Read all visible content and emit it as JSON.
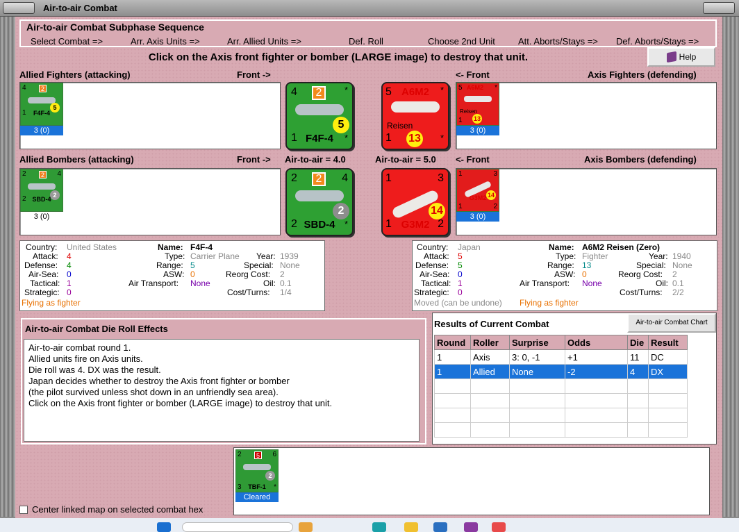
{
  "window": {
    "title": "Air-to-air Combat"
  },
  "sequence": {
    "title": "Air-to-air Combat Subphase Sequence",
    "steps": [
      "Select Combat =>",
      "Arr. Axis Units =>",
      "Arr. Allied Units =>",
      "Def. Roll",
      "Choose 2nd Unit",
      "Att. Aborts/Stays =>",
      "Def. Aborts/Stays =>"
    ]
  },
  "instruction": "Click on the Axis front fighter or bomber (LARGE image) to destroy that unit.",
  "help_label": "Help",
  "labels": {
    "allied_fighters": "Allied Fighters (attacking)",
    "front_right": "Front ->",
    "front_left": "<- Front",
    "axis_fighters": "Axis Fighters (defending)",
    "allied_bombers": "Allied Bombers (attacking)",
    "a2a_allied": "Air-to-air = 4.0",
    "a2a_axis": "Air-to-air = 5.0",
    "axis_bombers": "Axis Bombers (defending)"
  },
  "units": {
    "allied_fighter_mini": {
      "tl": "4",
      "tag": "2",
      "circ": "5",
      "bl": "1",
      "name": "F4F-4",
      "bar": "3 (0)"
    },
    "allied_fighter_big": {
      "tl": "4",
      "tag": "2",
      "tr": "*",
      "circ": "5",
      "bl": "1",
      "name": "F4F-4",
      "br": "*"
    },
    "axis_fighter_big": {
      "tl": "5",
      "topname": "A6M2",
      "tr": "*",
      "sub": "Reisen",
      "circ": "13",
      "bl": "1",
      "br": "*"
    },
    "axis_fighter_mini": {
      "tl": "5",
      "top": "A6M2",
      "tr": "*",
      "sub": "Reisen",
      "circ": "13",
      "bl": "1",
      "bar": "3 (0)"
    },
    "allied_bomber_mini": {
      "tl": "2",
      "tag": "2",
      "tr": "4",
      "circ": "2",
      "bl": "2",
      "name": "SBD-4",
      "bar": "3 (0)"
    },
    "allied_bomber_big": {
      "tl": "2",
      "tag": "2",
      "tr": "4",
      "circ": "2",
      "bl": "2",
      "name": "SBD-4",
      "br": "*"
    },
    "axis_bomber_big": {
      "tl": "1",
      "tr": "3",
      "circ": "14",
      "bl": "1",
      "name": "G3M2",
      "br": "2"
    },
    "axis_bomber_mini": {
      "tl": "1",
      "tr": "3",
      "circ": "14",
      "bl": "1",
      "name": "G3M2",
      "br": "2",
      "bar": "3 (0)"
    },
    "bottom_mini": {
      "tl": "2",
      "tag": "5",
      "tr": "6",
      "circ": "2",
      "bl": "3",
      "name": "TBF-1",
      "br": "*",
      "bar": "Cleared"
    }
  },
  "allied_info": {
    "country_k": "Country:",
    "country_v": "United States",
    "attack_k": "Attack:",
    "attack_v": "4",
    "defense_k": "Defense:",
    "defense_v": "4",
    "airsea_k": "Air-Sea:",
    "airsea_v": "0",
    "tactical_k": "Tactical:",
    "tactical_v": "1",
    "strategic_k": "Strategic:",
    "strategic_v": "0",
    "status": "Flying as fighter",
    "name_k": "Name:",
    "name_v": "F4F-4",
    "type_k": "Type:",
    "type_v": "Carrier Plane",
    "range_k": "Range:",
    "range_v": "5",
    "asw_k": "ASW:",
    "asw_v": "0",
    "airtransport_k": "Air Transport:",
    "airtransport_v": "None",
    "year_k": "Year:",
    "year_v": "1939",
    "special_k": "Special:",
    "special_v": "None",
    "reorg_k": "Reorg Cost:",
    "reorg_v": "2",
    "oil_k": "Oil:",
    "oil_v": "0.1",
    "cost_k": "Cost/Turns:",
    "cost_v": "1/4"
  },
  "axis_info": {
    "country_k": "Country:",
    "country_v": "Japan",
    "attack_k": "Attack:",
    "attack_v": "5",
    "defense_k": "Defense:",
    "defense_v": "5",
    "airsea_k": "Air-Sea:",
    "airsea_v": "0",
    "tactical_k": "Tactical:",
    "tactical_v": "1",
    "strategic_k": "Strategic:",
    "strategic_v": "0",
    "moved": "Moved (can be undone)",
    "status": "Flying as fighter",
    "name_k": "Name:",
    "name_v": "A6M2 Reisen (Zero)",
    "type_k": "Type:",
    "type_v": "Fighter",
    "range_k": "Range:",
    "range_v": "13",
    "asw_k": "ASW:",
    "asw_v": "0",
    "airtransport_k": "Air Transport:",
    "airtransport_v": "None",
    "year_k": "Year:",
    "year_v": "1940",
    "special_k": "Special:",
    "special_v": "None",
    "reorg_k": "Reorg Cost:",
    "reorg_v": "2",
    "oil_k": "Oil:",
    "oil_v": "0.1",
    "cost_k": "Cost/Turns:",
    "cost_v": "2/2"
  },
  "effects": {
    "title": "Air-to-air Combat Die Roll Effects",
    "lines": [
      "Air-to-air combat round 1.",
      "Allied units fire on Axis units.",
      "Die roll was 4.  DX was the result.",
      "Japan decides whether to destroy the Axis front fighter or bomber",
      "(the pilot survived unless shot down in an unfriendly sea area).",
      "Click on the Axis front fighter or bomber (LARGE image) to destroy that unit."
    ]
  },
  "results": {
    "title": "Results of Current Combat",
    "chart_button": "Air-to-air Combat Chart",
    "headers": [
      "Round",
      "Roller",
      "Surprise",
      "Odds",
      "Die",
      "Result"
    ],
    "rows": [
      [
        "1",
        "Axis",
        "3: 0, -1",
        "+1",
        "11",
        "DC"
      ],
      [
        "1",
        "Allied",
        "None",
        "-2",
        "4",
        "DX"
      ]
    ]
  },
  "center_checkbox": "Center linked map on selected combat hex"
}
